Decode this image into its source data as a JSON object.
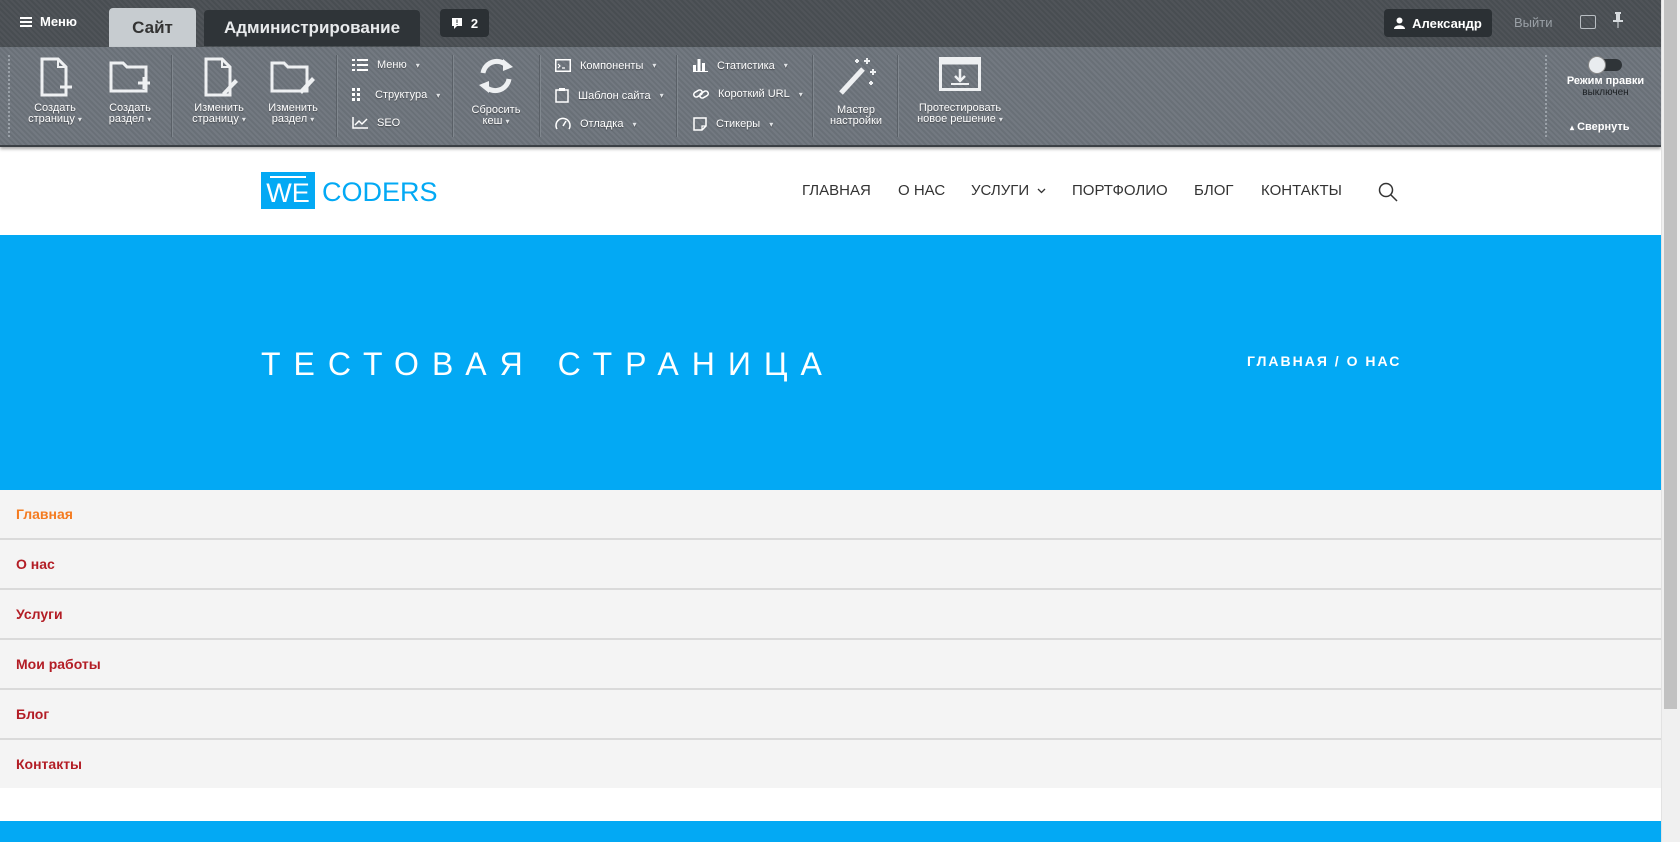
{
  "admin": {
    "menu_label": "Меню",
    "tabs": [
      {
        "label": "Сайт"
      },
      {
        "label": "Администрирование"
      }
    ],
    "notifications_count": "2",
    "user_name": "Александр",
    "logout_label": "Выйти"
  },
  "toolbar": {
    "create_page": [
      "Создать",
      "страницу"
    ],
    "create_section": [
      "Создать",
      "раздел"
    ],
    "edit_page": [
      "Изменить",
      "страницу"
    ],
    "edit_section": [
      "Изменить",
      "раздел"
    ],
    "menu": "Меню",
    "structure": "Структура",
    "seo": "SEO",
    "reset_cache": [
      "Сбросить",
      "кеш"
    ],
    "components": "Компоненты",
    "site_template": "Шаблон сайта",
    "debug": "Отладка",
    "statistics": "Статистика",
    "short_url": "Короткий URL",
    "stickers": "Стикеры",
    "wizard": [
      "Мастер",
      "настройки"
    ],
    "test_solution": [
      "Протестировать",
      "новое решение"
    ],
    "edit_mode_label": "Режим правки",
    "edit_mode_state": "выключен",
    "collapse_label": "Свернуть"
  },
  "site": {
    "logo_we": "WE",
    "logo_coders": "CODERS",
    "nav": [
      {
        "label": "ГЛАВНАЯ"
      },
      {
        "label": "О НАС"
      },
      {
        "label": "УСЛУГИ"
      },
      {
        "label": "ПОРТФОЛИО"
      },
      {
        "label": "БЛОГ"
      },
      {
        "label": "КОНТАКТЫ"
      }
    ],
    "hero_title": "ТЕСТОВАЯ СТРАНИЦА",
    "breadcrumb": "ГЛАВНАЯ / О НАС",
    "side_menu": [
      {
        "label": "Главная"
      },
      {
        "label": "О нас"
      },
      {
        "label": "Услуги"
      },
      {
        "label": "Мои работы"
      },
      {
        "label": "Блог"
      },
      {
        "label": "Контакты"
      }
    ]
  },
  "colors": {
    "accent": "#03a9f4",
    "link": "#b31d25",
    "active_link": "#f47b20",
    "admin_bar": "#4a4f54",
    "toolbar": "#6d747c"
  }
}
